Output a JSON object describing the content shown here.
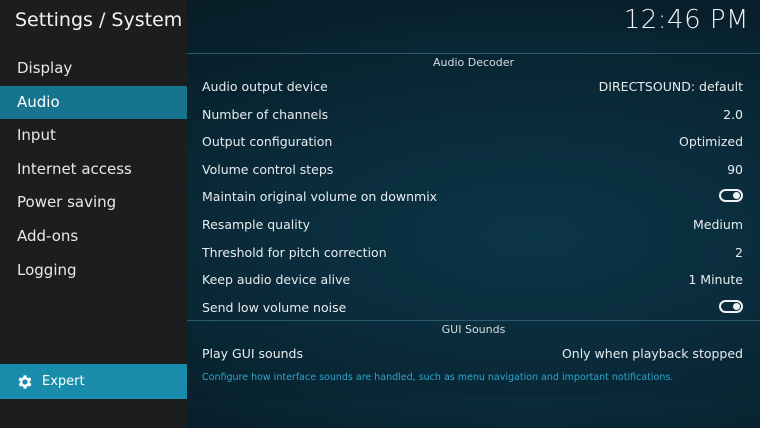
{
  "header": {
    "title": "Settings / System",
    "clock": "12:46 PM"
  },
  "sidebar": {
    "items": [
      {
        "label": "Display"
      },
      {
        "label": "Audio",
        "active": true
      },
      {
        "label": "Input"
      },
      {
        "label": "Internet access"
      },
      {
        "label": "Power saving"
      },
      {
        "label": "Add-ons"
      },
      {
        "label": "Logging"
      }
    ],
    "expert": {
      "label": "Expert",
      "icon": "gear-icon"
    }
  },
  "sections": {
    "audio_decoder": {
      "title": "Audio Decoder",
      "rows": [
        {
          "name": "Audio output device",
          "value": "DIRECTSOUND: default"
        },
        {
          "name": "Number of channels",
          "value": "2.0"
        },
        {
          "name": "Output configuration",
          "value": "Optimized"
        },
        {
          "name": "Volume control steps",
          "value": "90"
        },
        {
          "name": "Maintain original volume on downmix",
          "toggle": true
        },
        {
          "name": "Resample quality",
          "value": "Medium"
        },
        {
          "name": "Threshold for pitch correction",
          "value": "2"
        },
        {
          "name": "Keep audio device alive",
          "value": "1 Minute"
        },
        {
          "name": "Send low volume noise",
          "toggle": true
        }
      ]
    },
    "gui_sounds": {
      "title": "GUI Sounds",
      "rows": [
        {
          "name": "Play GUI sounds",
          "value": "Only when playback stopped"
        }
      ]
    }
  },
  "footer": {
    "hint": "Configure how interface sounds are handled, such as menu navigation and important notifications."
  },
  "colors": {
    "accent": "#1a8cab",
    "active_nav": "#17748f",
    "hint_text": "#2fa6c9"
  }
}
